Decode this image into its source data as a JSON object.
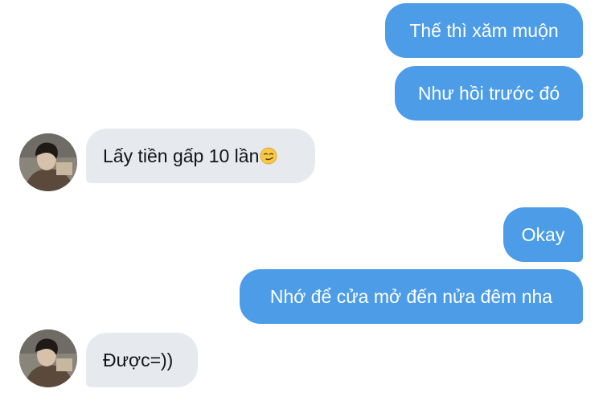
{
  "messages": [
    {
      "direction": "outgoing",
      "text": "Thế thì xăm muộn"
    },
    {
      "direction": "outgoing",
      "text": "Như hồi trước đó"
    },
    {
      "direction": "incoming",
      "text": "Lấy tiền gấp 10 lần",
      "emoji": "smirking-face-icon"
    },
    {
      "direction": "outgoing",
      "text": "Okay"
    },
    {
      "direction": "outgoing",
      "text": "Nhớ để cửa mở đến nửa đêm nha"
    },
    {
      "direction": "incoming",
      "text": "Được=))"
    }
  ],
  "colors": {
    "outgoing_bubble": "#4c9ce8",
    "incoming_bubble": "#e6e9ed",
    "outgoing_text": "#ffffff",
    "incoming_text": "#111418"
  }
}
